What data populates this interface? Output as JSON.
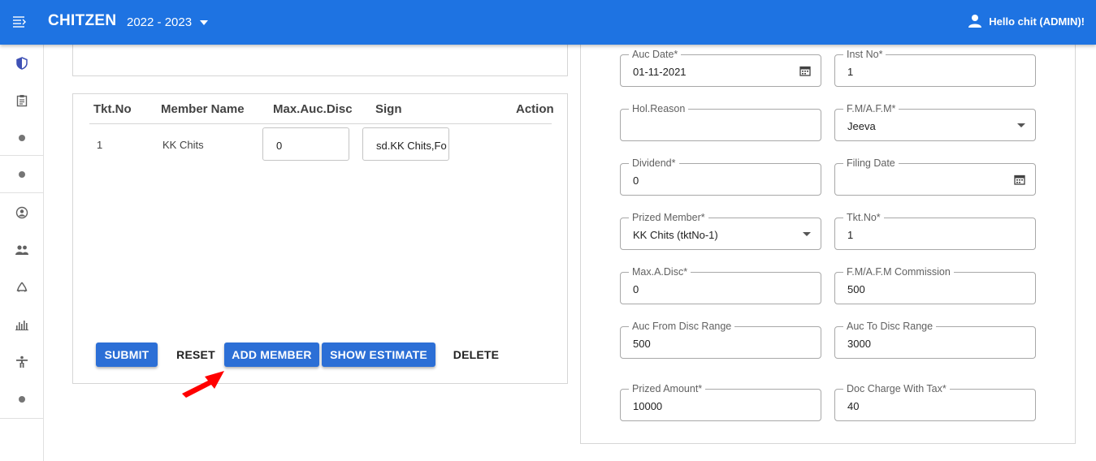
{
  "app": {
    "brand": "CHITZEN",
    "year": "2022 - 2023",
    "user": "Hello chit (ADMIN)!",
    "accent_color": "#1e73e2"
  },
  "sidebar": {
    "items": [
      {
        "icon": "shield-icon"
      },
      {
        "icon": "clipboard-icon"
      },
      {
        "icon": "dot-icon"
      },
      {
        "icon": "dot-icon"
      },
      {
        "icon": "account-circle-icon"
      },
      {
        "icon": "group-icon"
      },
      {
        "icon": "recycle-icon"
      },
      {
        "icon": "bar-chart-icon"
      },
      {
        "icon": "accessibility-icon"
      },
      {
        "icon": "dot-icon"
      }
    ]
  },
  "members_table": {
    "headers": {
      "tkt_no": "Tkt.No",
      "member_name": "Member Name",
      "max_auc_disc": "Max.Auc.Disc",
      "sign": "Sign",
      "action": "Action"
    },
    "rows": [
      {
        "tkt_no": "1",
        "member_name": "KK Chits",
        "max_auc_disc": "0",
        "sign": "sd.KK Chits,Fo"
      }
    ]
  },
  "actions": {
    "submit": "SUBMIT",
    "reset": "RESET",
    "add_member": "ADD MEMBER",
    "show_estimate": "SHOW ESTIMATE",
    "delete": "DELETE"
  },
  "form": {
    "auc_date": {
      "label": "Auc Date*",
      "value": "01-11-2021"
    },
    "inst_no": {
      "label": "Inst No*",
      "value": "1"
    },
    "hol_reason": {
      "label": "Hol.Reason",
      "value": ""
    },
    "fm_afm": {
      "label": "F.M/A.F.M*",
      "value": "Jeeva"
    },
    "dividend": {
      "label": "Dividend*",
      "value": "0"
    },
    "filing_date": {
      "label": "Filing Date",
      "value": ""
    },
    "prized_member": {
      "label": "Prized Member*",
      "value": "KK Chits (tktNo-1)"
    },
    "tkt_no": {
      "label": "Tkt.No*",
      "value": "1"
    },
    "max_a_disc": {
      "label": "Max.A.Disc*",
      "value": "0"
    },
    "fm_afm_commission": {
      "label": "F.M/A.F.M Commission",
      "value": "500"
    },
    "auc_from_disc_range": {
      "label": "Auc From Disc Range",
      "value": "500"
    },
    "auc_to_disc_range": {
      "label": "Auc To Disc Range",
      "value": "3000"
    },
    "prized_amount": {
      "label": "Prized Amount*",
      "value": "10000"
    },
    "doc_charge_with_tax": {
      "label": "Doc Charge With Tax*",
      "value": "40"
    }
  }
}
